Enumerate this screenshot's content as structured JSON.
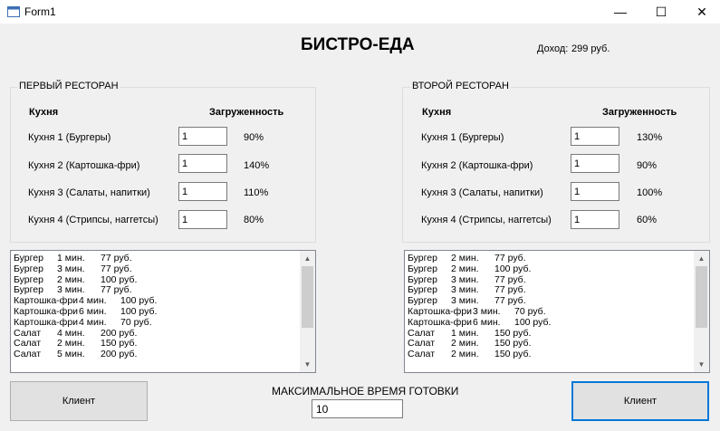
{
  "window": {
    "title": "Form1",
    "minimize_glyph": "—",
    "maximize_glyph": "☐",
    "close_glyph": "✕"
  },
  "header": {
    "title": "БИСТРО-ЕДА",
    "income_label": "Доход:",
    "income_value": "299 руб."
  },
  "restaurant1": {
    "title": "ПЕРВЫЙ РЕСТОРАН",
    "col_kitchen": "Кухня",
    "col_load": "Загруженность",
    "kitchens": [
      {
        "label": "Кухня 1 (Бургеры)",
        "value": "1",
        "load": "90%"
      },
      {
        "label": "Кухня 2 (Картошка-фри)",
        "value": "1",
        "load": "140%"
      },
      {
        "label": "Кухня 3 (Салаты, напитки)",
        "value": "1",
        "load": "110%"
      },
      {
        "label": "Кухня 4 (Стрипсы, наггетсы)",
        "value": "1",
        "load": "80%"
      }
    ],
    "orders": [
      {
        "item": "Бургер",
        "time": "1 мин.",
        "price": "77 руб."
      },
      {
        "item": "Бургер",
        "time": "3 мин.",
        "price": "77 руб."
      },
      {
        "item": "Бургер",
        "time": "2 мин.",
        "price": "100 руб."
      },
      {
        "item": "Бургер",
        "time": "3 мин.",
        "price": "77 руб."
      },
      {
        "item": "Картошка-фри",
        "time": "4 мин.",
        "price": "100 руб."
      },
      {
        "item": "Картошка-фри",
        "time": "6 мин.",
        "price": "100 руб."
      },
      {
        "item": "Картошка-фри",
        "time": "4 мин.",
        "price": "70 руб."
      },
      {
        "item": "Салат",
        "time": "4 мин.",
        "price": "200 руб."
      },
      {
        "item": "Салат",
        "time": "2 мин.",
        "price": "150 руб."
      },
      {
        "item": "Салат",
        "time": "5 мин.",
        "price": "200 руб."
      }
    ],
    "client_button": "Клиент"
  },
  "restaurant2": {
    "title": "ВТОРОЙ РЕСТОРАН",
    "col_kitchen": "Кухня",
    "col_load": "Загруженность",
    "kitchens": [
      {
        "label": "Кухня 1 (Бургеры)",
        "value": "1",
        "load": "130%"
      },
      {
        "label": "Кухня 2 (Картошка-фри)",
        "value": "1",
        "load": "90%"
      },
      {
        "label": "Кухня 3 (Салаты, напитки)",
        "value": "1",
        "load": "100%"
      },
      {
        "label": "Кухня 4 (Стрипсы, наггетсы)",
        "value": "1",
        "load": "60%"
      }
    ],
    "orders": [
      {
        "item": "Бургер",
        "time": "2 мин.",
        "price": "77 руб."
      },
      {
        "item": "Бургер",
        "time": "2 мин.",
        "price": "100 руб."
      },
      {
        "item": "Бургер",
        "time": "3 мин.",
        "price": "77 руб."
      },
      {
        "item": "Бургер",
        "time": "3 мин.",
        "price": "77 руб."
      },
      {
        "item": "Бургер",
        "time": "3 мин.",
        "price": "77 руб."
      },
      {
        "item": "Картошка-фри",
        "time": "3 мин.",
        "price": "70 руб."
      },
      {
        "item": "Картошка-фри",
        "time": "6 мин.",
        "price": "100 руб."
      },
      {
        "item": "Салат",
        "time": "1 мин.",
        "price": "150 руб."
      },
      {
        "item": "Салат",
        "time": "2 мин.",
        "price": "150 руб."
      },
      {
        "item": "Салат",
        "time": "2 мин.",
        "price": "150 руб."
      }
    ],
    "client_button": "Клиент"
  },
  "footer": {
    "max_time_label": "МАКСИМАЛЬНОЕ ВРЕМЯ ГОТОВКИ",
    "max_time_value": "10"
  },
  "colors": {
    "focus_border": "#0078d7",
    "window_bg": "#f0f0f0"
  },
  "icons": [
    "form-icon",
    "scroll-up-icon",
    "scroll-down-icon"
  ]
}
